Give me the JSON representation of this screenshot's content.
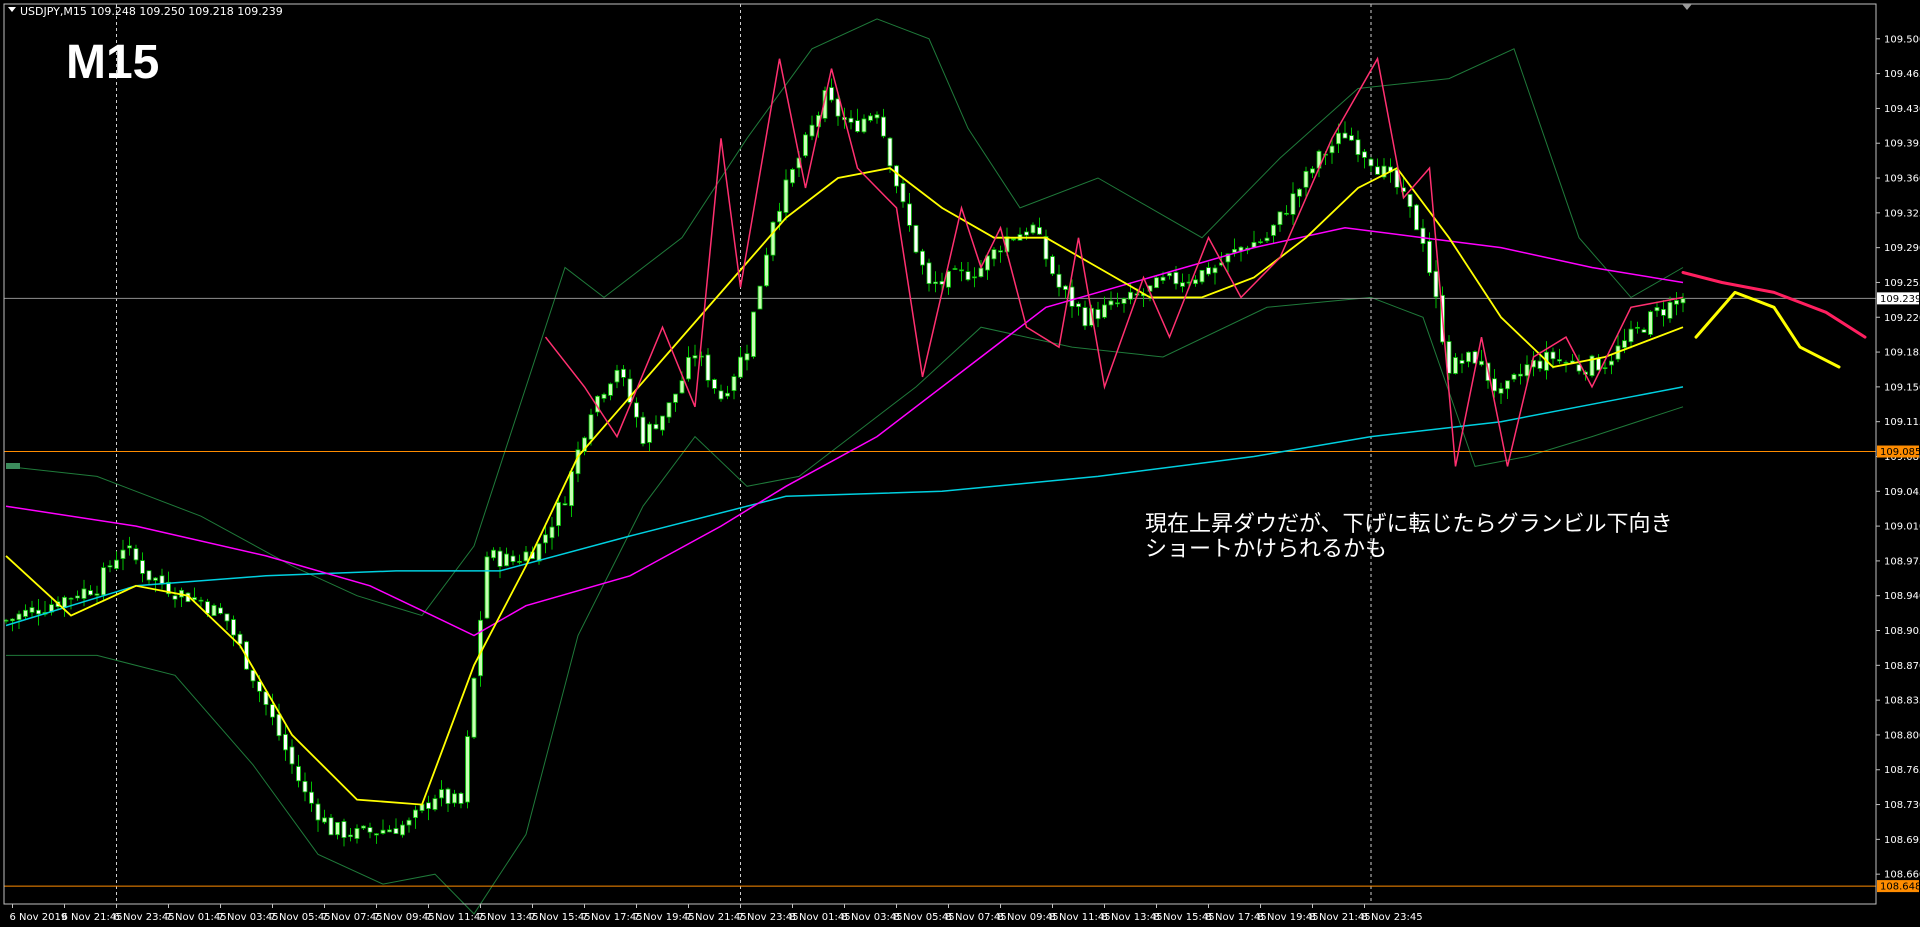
{
  "header": {
    "symbol_line": "USDJPY,M15  109.248 109.250 109.218 109.239",
    "timeframe_label": "M15"
  },
  "annotation": {
    "line1": "現在上昇ダウだが、下げに転じたらグランビル下向き",
    "line2": "ショートかけられるかも"
  },
  "colors": {
    "background": "#000000",
    "axis": "#c0c0c0",
    "bull_candle": "#c8ffb4",
    "bear_candle": "#ffffff",
    "wick": "#00c000",
    "bollinger": "#1f7a3a",
    "ma_yellow": "#ffff00",
    "ma_magenta": "#ff00ff",
    "ma_cyan": "#00d0e0",
    "zigzag": "#ff3070",
    "hline": "#ff8c00",
    "bid_line": "#909090",
    "forecast_red": "#ff2060",
    "forecast_yellow": "#ffff00"
  },
  "chart_data": {
    "type": "candlestick",
    "symbol": "USDJPY",
    "timeframe": "M15",
    "ylim": [
      108.63,
      109.535
    ],
    "y_ticks": [
      "109.500",
      "109.465",
      "109.430",
      "109.395",
      "109.360",
      "109.325",
      "109.290",
      "109.255",
      "109.220",
      "109.185",
      "109.150",
      "109.115",
      "109.080",
      "109.045",
      "109.010",
      "108.975",
      "108.940",
      "108.905",
      "108.870",
      "108.835",
      "108.800",
      "108.765",
      "108.730",
      "108.695",
      "108.660",
      "108.625"
    ],
    "x_ticks": [
      "6 Nov 2019",
      "6 Nov 21:45",
      "6 Nov 23:45",
      "7 Nov 01:45",
      "7 Nov 03:45",
      "7 Nov 05:45",
      "7 Nov 07:45",
      "7 Nov 09:45",
      "7 Nov 11:45",
      "7 Nov 13:45",
      "7 Nov 15:45",
      "7 Nov 17:45",
      "7 Nov 19:45",
      "7 Nov 21:45",
      "7 Nov 23:45",
      "8 Nov 01:45",
      "8 Nov 03:45",
      "8 Nov 05:45",
      "8 Nov 07:45",
      "8 Nov 09:45",
      "8 Nov 11:45",
      "8 Nov 13:45",
      "8 Nov 15:45",
      "8 Nov 17:45",
      "8 Nov 19:45",
      "8 Nov 21:45",
      "8 Nov 23:45"
    ],
    "price_badges": [
      {
        "value": "109.239",
        "price": 109.239,
        "bg": "#ffffff",
        "fg": "#000000"
      },
      {
        "value": "109.085",
        "price": 109.085,
        "bg": "#ff8c00",
        "fg": "#000000"
      },
      {
        "value": "108.648",
        "price": 108.648,
        "bg": "#ff8c00",
        "fg": "#000000"
      }
    ],
    "horizontal_lines": [
      109.085,
      108.648
    ],
    "bid_line": 109.239,
    "period_separators": [
      "6 Nov 23:45",
      "7 Nov 23:45",
      "8 Nov 23:45"
    ],
    "candles_step_count": 186,
    "close_anchors": [
      [
        0,
        108.915
      ],
      [
        8,
        108.935
      ],
      [
        14,
        108.95
      ],
      [
        18,
        108.99
      ],
      [
        22,
        108.96
      ],
      [
        26,
        108.945
      ],
      [
        30,
        108.935
      ],
      [
        34,
        108.915
      ],
      [
        38,
        108.86
      ],
      [
        42,
        108.8
      ],
      [
        46,
        108.74
      ],
      [
        50,
        108.705
      ],
      [
        54,
        108.7
      ],
      [
        58,
        108.705
      ],
      [
        62,
        108.71
      ],
      [
        66,
        108.74
      ],
      [
        70,
        108.73
      ],
      [
        74,
        108.98
      ],
      [
        78,
        108.975
      ],
      [
        82,
        108.99
      ],
      [
        86,
        109.04
      ],
      [
        90,
        109.13
      ],
      [
        94,
        109.17
      ],
      [
        98,
        109.1
      ],
      [
        102,
        109.13
      ],
      [
        106,
        109.185
      ],
      [
        110,
        109.14
      ],
      [
        114,
        109.19
      ],
      [
        118,
        109.32
      ],
      [
        122,
        109.38
      ],
      [
        126,
        109.44
      ],
      [
        130,
        109.41
      ],
      [
        134,
        109.43
      ],
      [
        138,
        109.33
      ],
      [
        142,
        109.25
      ],
      [
        146,
        109.26
      ],
      [
        150,
        109.27
      ],
      [
        154,
        109.3
      ],
      [
        158,
        109.31
      ],
      [
        162,
        109.25
      ],
      [
        166,
        109.22
      ],
      [
        170,
        109.23
      ],
      [
        174,
        109.24
      ],
      [
        178,
        109.255
      ],
      [
        182,
        109.26
      ],
      [
        186,
        109.27
      ],
      [
        190,
        109.29
      ],
      [
        194,
        109.3
      ],
      [
        198,
        109.34
      ],
      [
        202,
        109.38
      ],
      [
        206,
        109.405
      ],
      [
        210,
        109.38
      ],
      [
        214,
        109.35
      ],
      [
        218,
        109.3
      ],
      [
        222,
        109.17
      ],
      [
        226,
        109.18
      ],
      [
        230,
        109.14
      ],
      [
        234,
        109.17
      ],
      [
        238,
        109.18
      ],
      [
        242,
        109.17
      ],
      [
        246,
        109.175
      ],
      [
        250,
        109.2
      ],
      [
        254,
        109.225
      ],
      [
        258,
        109.239
      ]
    ],
    "ma_yellow": [
      [
        0,
        108.98
      ],
      [
        10,
        108.92
      ],
      [
        20,
        108.95
      ],
      [
        28,
        108.94
      ],
      [
        36,
        108.89
      ],
      [
        44,
        108.8
      ],
      [
        54,
        108.735
      ],
      [
        64,
        108.73
      ],
      [
        72,
        108.87
      ],
      [
        80,
        108.97
      ],
      [
        88,
        109.08
      ],
      [
        96,
        109.14
      ],
      [
        104,
        109.2
      ],
      [
        112,
        109.26
      ],
      [
        120,
        109.32
      ],
      [
        128,
        109.36
      ],
      [
        136,
        109.37
      ],
      [
        144,
        109.33
      ],
      [
        152,
        109.3
      ],
      [
        160,
        109.3
      ],
      [
        168,
        109.27
      ],
      [
        176,
        109.24
      ],
      [
        184,
        109.24
      ],
      [
        192,
        109.26
      ],
      [
        200,
        109.3
      ],
      [
        208,
        109.35
      ],
      [
        214,
        109.37
      ],
      [
        222,
        109.3
      ],
      [
        230,
        109.22
      ],
      [
        238,
        109.17
      ],
      [
        246,
        109.18
      ],
      [
        254,
        109.2
      ],
      [
        258,
        109.21
      ]
    ],
    "ma_magenta": [
      [
        0,
        109.03
      ],
      [
        20,
        109.01
      ],
      [
        40,
        108.98
      ],
      [
        56,
        108.95
      ],
      [
        64,
        108.925
      ],
      [
        72,
        108.9
      ],
      [
        80,
        108.93
      ],
      [
        96,
        108.96
      ],
      [
        110,
        109.01
      ],
      [
        120,
        109.05
      ],
      [
        134,
        109.1
      ],
      [
        148,
        109.17
      ],
      [
        160,
        109.23
      ],
      [
        176,
        109.26
      ],
      [
        192,
        109.29
      ],
      [
        206,
        109.31
      ],
      [
        218,
        109.3
      ],
      [
        230,
        109.29
      ],
      [
        244,
        109.27
      ],
      [
        258,
        109.255
      ]
    ],
    "ma_cyan": [
      [
        0,
        108.91
      ],
      [
        20,
        108.95
      ],
      [
        40,
        108.96
      ],
      [
        60,
        108.965
      ],
      [
        76,
        108.965
      ],
      [
        96,
        109.0
      ],
      [
        120,
        109.04
      ],
      [
        144,
        109.045
      ],
      [
        168,
        109.06
      ],
      [
        192,
        109.08
      ],
      [
        210,
        109.1
      ],
      [
        230,
        109.115
      ],
      [
        250,
        109.14
      ],
      [
        258,
        109.15
      ]
    ],
    "bb_upper": [
      [
        0,
        109.07
      ],
      [
        14,
        109.06
      ],
      [
        30,
        109.02
      ],
      [
        44,
        108.97
      ],
      [
        54,
        108.94
      ],
      [
        64,
        108.92
      ],
      [
        72,
        108.99
      ],
      [
        80,
        109.15
      ],
      [
        86,
        109.27
      ],
      [
        92,
        109.24
      ],
      [
        104,
        109.3
      ],
      [
        114,
        109.4
      ],
      [
        124,
        109.49
      ],
      [
        134,
        109.52
      ],
      [
        142,
        109.5
      ],
      [
        148,
        109.41
      ],
      [
        156,
        109.33
      ],
      [
        168,
        109.36
      ],
      [
        184,
        109.3
      ],
      [
        196,
        109.38
      ],
      [
        208,
        109.45
      ],
      [
        222,
        109.46
      ],
      [
        232,
        109.49
      ],
      [
        242,
        109.3
      ],
      [
        250,
        109.24
      ],
      [
        258,
        109.27
      ]
    ],
    "bb_lower": [
      [
        0,
        108.88
      ],
      [
        14,
        108.88
      ],
      [
        26,
        108.86
      ],
      [
        38,
        108.77
      ],
      [
        48,
        108.68
      ],
      [
        58,
        108.65
      ],
      [
        66,
        108.66
      ],
      [
        72,
        108.62
      ],
      [
        80,
        108.7
      ],
      [
        88,
        108.9
      ],
      [
        98,
        109.03
      ],
      [
        106,
        109.1
      ],
      [
        114,
        109.05
      ],
      [
        122,
        109.06
      ],
      [
        130,
        109.1
      ],
      [
        140,
        109.15
      ],
      [
        150,
        109.21
      ],
      [
        164,
        109.19
      ],
      [
        178,
        109.18
      ],
      [
        194,
        109.23
      ],
      [
        210,
        109.24
      ],
      [
        218,
        109.22
      ],
      [
        226,
        109.07
      ],
      [
        234,
        109.08
      ],
      [
        244,
        109.1
      ],
      [
        258,
        109.13
      ]
    ],
    "zigzag": [
      [
        83,
        109.2
      ],
      [
        89,
        109.15
      ],
      [
        94,
        109.1
      ],
      [
        101,
        109.21
      ],
      [
        106,
        109.13
      ],
      [
        110,
        109.4
      ],
      [
        113,
        109.25
      ],
      [
        119,
        109.48
      ],
      [
        123,
        109.35
      ],
      [
        127,
        109.47
      ],
      [
        131,
        109.37
      ],
      [
        137,
        109.33
      ],
      [
        141,
        109.16
      ],
      [
        147,
        109.33
      ],
      [
        150,
        109.27
      ],
      [
        153,
        109.31
      ],
      [
        157,
        109.21
      ],
      [
        162,
        109.19
      ],
      [
        165,
        109.3
      ],
      [
        169,
        109.15
      ],
      [
        175,
        109.26
      ],
      [
        179,
        109.2
      ],
      [
        185,
        109.3
      ],
      [
        190,
        109.24
      ],
      [
        196,
        109.28
      ],
      [
        204,
        109.4
      ],
      [
        211,
        109.48
      ],
      [
        215,
        109.34
      ],
      [
        219,
        109.37
      ],
      [
        223,
        109.07
      ],
      [
        227,
        109.2
      ],
      [
        231,
        109.07
      ],
      [
        235,
        109.18
      ],
      [
        240,
        109.2
      ],
      [
        244,
        109.15
      ],
      [
        250,
        109.23
      ],
      [
        258,
        109.24
      ]
    ],
    "forecast_red": [
      [
        258,
        109.265
      ],
      [
        264,
        109.255
      ],
      [
        272,
        109.245
      ],
      [
        280,
        109.225
      ],
      [
        286,
        109.2
      ]
    ],
    "forecast_yellow": [
      [
        260,
        109.2
      ],
      [
        266,
        109.245
      ],
      [
        272,
        109.23
      ],
      [
        276,
        109.19
      ],
      [
        282,
        109.17
      ]
    ]
  }
}
